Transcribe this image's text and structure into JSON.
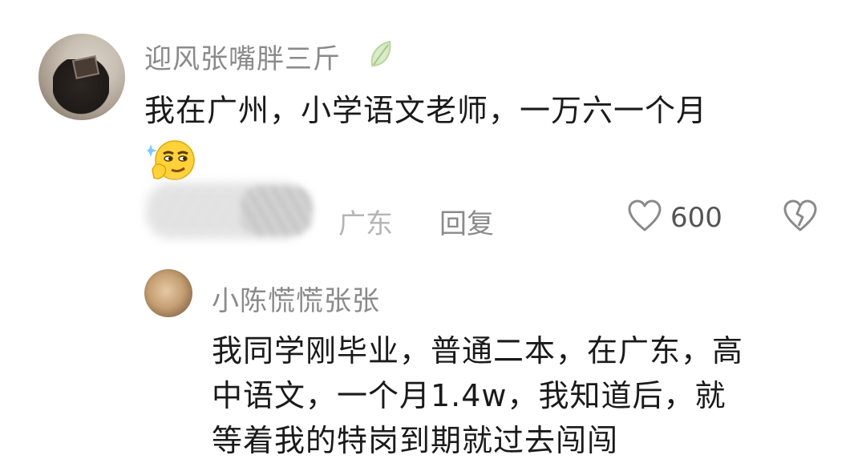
{
  "comment": {
    "username": "迎风张嘴胖三斤",
    "username_badge_icon": "leaf-icon",
    "text": "我在广州，小学语文老师，一万六一个月",
    "emoji": "thinking-smirk-emoji",
    "location": "广东",
    "reply_label": "回复",
    "like_count": "600",
    "like_icon": "heart-icon",
    "dislike_icon": "broken-heart-icon"
  },
  "reply": {
    "username": "小陈慌慌张张",
    "lines": [
      "我同学刚毕业，普通二本，在广东，高",
      "中语文，一个月1.4w，我知道后，就",
      "等着我的特岗到期就过去闯闯"
    ]
  }
}
